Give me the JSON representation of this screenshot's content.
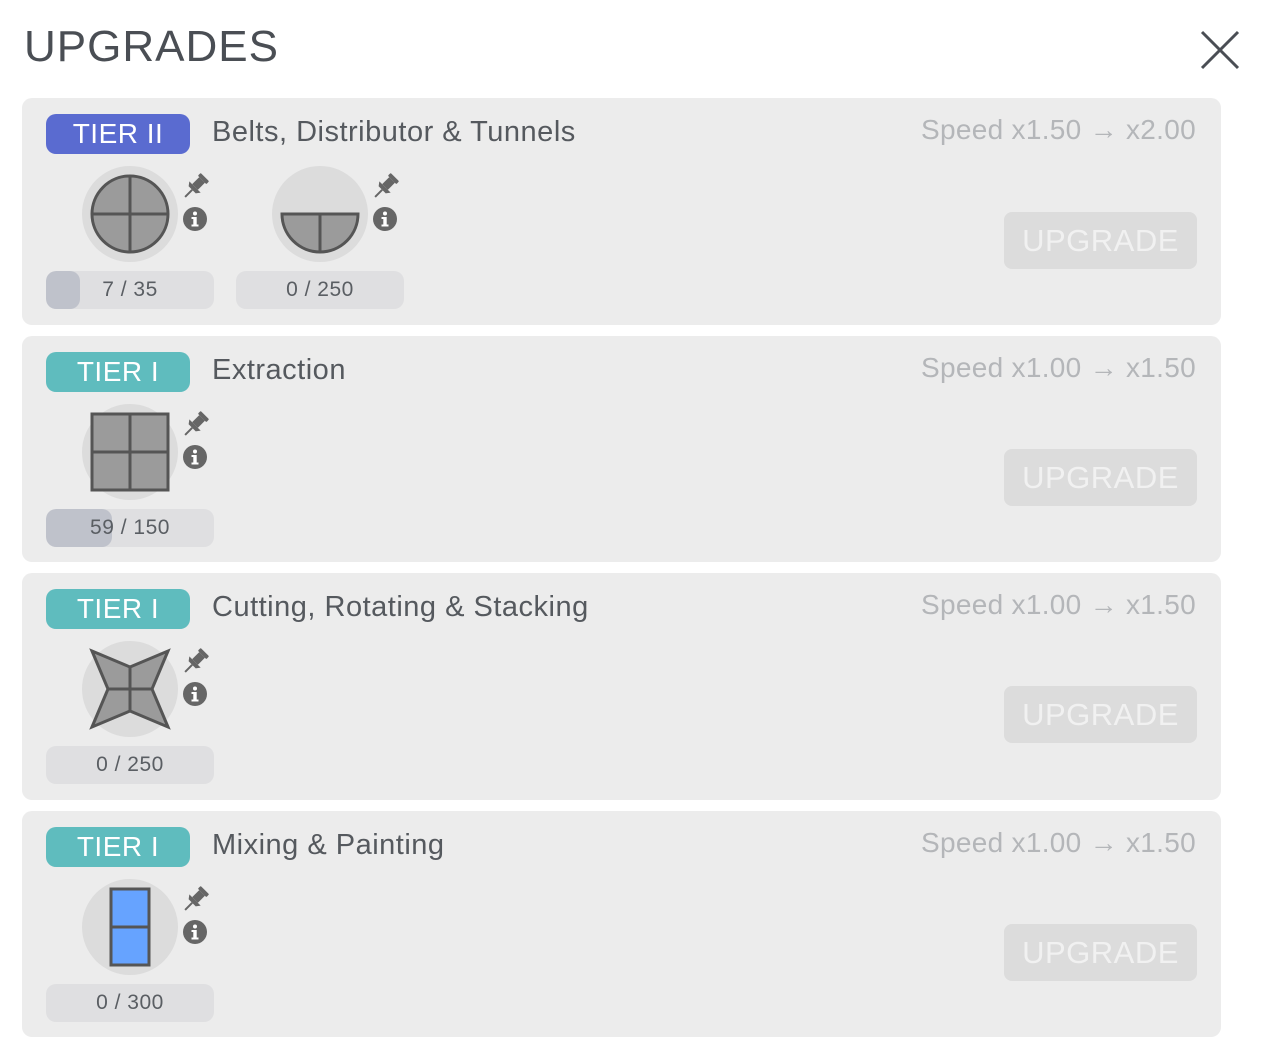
{
  "window": {
    "title": "UPGRADES",
    "close_icon": "close-icon"
  },
  "colors": {
    "tier2": "#5a6bd0",
    "tier1": "#5fbcbe",
    "shape_gray": "#9b9b9b",
    "shape_blue": "#66a3ff"
  },
  "upgrades": [
    {
      "tier": "TIER II",
      "name": "Belts, Distributor & Tunnels",
      "speed": "Speed x1.50 → x2.00",
      "button": "UPGRADE",
      "requirements": [
        {
          "shape": "circle-quarters",
          "progress": "7 / 35",
          "fraction": 0.2
        },
        {
          "shape": "half-circle",
          "progress": "0 / 250",
          "fraction": 0
        }
      ]
    },
    {
      "tier": "TIER I",
      "name": "Extraction",
      "speed": "Speed x1.00 → x1.50",
      "button": "UPGRADE",
      "requirements": [
        {
          "shape": "square-quarters",
          "progress": "59 / 150",
          "fraction": 0.393
        }
      ]
    },
    {
      "tier": "TIER I",
      "name": "Cutting, Rotating & Stacking",
      "speed": "Speed x1.00 → x1.50",
      "button": "UPGRADE",
      "requirements": [
        {
          "shape": "star-quarters",
          "progress": "0 / 250",
          "fraction": 0
        }
      ]
    },
    {
      "tier": "TIER I",
      "name": "Mixing & Painting",
      "speed": "Speed x1.00 → x1.50",
      "button": "UPGRADE",
      "requirements": [
        {
          "shape": "blue-rect-halves",
          "progress": "0 / 300",
          "fraction": 0
        }
      ]
    }
  ]
}
